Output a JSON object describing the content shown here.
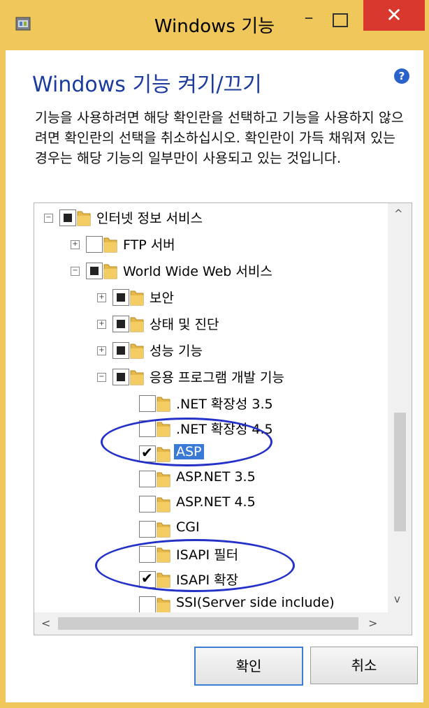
{
  "window": {
    "title": "Windows 기능",
    "minimize_glyph": "–",
    "close_glyph": "✕"
  },
  "dialog": {
    "heading": "Windows 기능 켜기/끄기",
    "help_glyph": "?",
    "description": "기능을 사용하려면 해당 확인란을 선택하고 기능을 사용하지 않으려면 확인란의 선택을 취소하십시오. 확인란이 가득 채워져 있는 경우는 해당 기능의 일부만이 사용되고 있는 것입니다."
  },
  "tree": {
    "items": [
      {
        "label": "인터넷 정보 서비스",
        "state": "partial",
        "expander": "collapse"
      },
      {
        "label": "FTP 서버",
        "state": "unchecked",
        "expander": "expand"
      },
      {
        "label": "World Wide Web 서비스",
        "state": "partial",
        "expander": "collapse"
      },
      {
        "label": "보안",
        "state": "partial",
        "expander": "expand"
      },
      {
        "label": "상태 및 진단",
        "state": "partial",
        "expander": "expand"
      },
      {
        "label": "성능 기능",
        "state": "partial",
        "expander": "expand"
      },
      {
        "label": "응용 프로그램 개발 기능",
        "state": "partial",
        "expander": "collapse"
      },
      {
        "label": ".NET 확장성 3.5",
        "state": "unchecked"
      },
      {
        "label": ".NET 확장성 4.5",
        "state": "unchecked"
      },
      {
        "label": "ASP",
        "state": "checked",
        "selected": true
      },
      {
        "label": "ASP.NET 3.5",
        "state": "unchecked"
      },
      {
        "label": "ASP.NET 4.5",
        "state": "unchecked"
      },
      {
        "label": "CGI",
        "state": "unchecked"
      },
      {
        "label": "ISAPI 필터",
        "state": "unchecked"
      },
      {
        "label": "ISAPI 확장",
        "state": "checked"
      },
      {
        "label": "SSI(Server side include)",
        "state": "unchecked"
      }
    ]
  },
  "scrollbar": {
    "up_glyph": "^",
    "down_glyph": "v",
    "left_glyph": "<",
    "right_glyph": ">"
  },
  "buttons": {
    "ok_label": "확인",
    "cancel_label": "취소"
  },
  "colors": {
    "title_bar": "#f0c75a",
    "close_button": "#d9382e",
    "heading_text": "#1b3c9e",
    "selection": "#3a79d6",
    "annotation_circle": "#2431c8"
  }
}
